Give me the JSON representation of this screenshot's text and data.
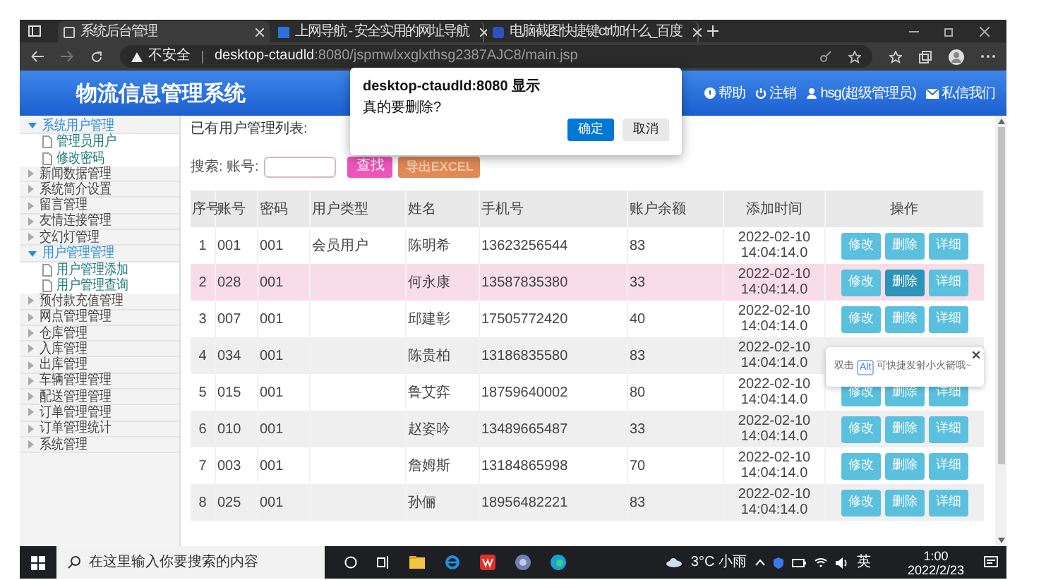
{
  "browser": {
    "tabs": [
      {
        "title": "系统后台管理",
        "selected": true
      },
      {
        "title": "上网导航 - 安全实用的网址导航",
        "selected": false
      },
      {
        "title": "电脑截图快捷键ctrl加什么_百度",
        "selected": false
      }
    ],
    "security": "不安全",
    "url_host": "desktop-ctaudld",
    "url_rest": ":8080/jspmwlxxglxthsg2387AJC8/main.jsp"
  },
  "header": {
    "title": "物流信息管理系统",
    "links": [
      {
        "kind": "help",
        "label": "帮助"
      },
      {
        "kind": "logout",
        "label": "注销"
      },
      {
        "kind": "user",
        "label": "hsg(超级管理员)"
      },
      {
        "kind": "mail",
        "label": "私信我们"
      }
    ]
  },
  "sidebar": {
    "items": [
      {
        "label": "系统用户管理",
        "expanded": true,
        "children": [
          {
            "label": "管理员用户"
          },
          {
            "label": "修改密码"
          }
        ]
      },
      {
        "label": "新闻数据管理",
        "expanded": false
      },
      {
        "label": "系统简介设置",
        "expanded": false
      },
      {
        "label": "留言管理",
        "expanded": false
      },
      {
        "label": "友情连接管理",
        "expanded": false
      },
      {
        "label": "交幻灯管理",
        "expanded": false
      },
      {
        "label": "用户管理管理",
        "expanded": true,
        "children": [
          {
            "label": "用户管理添加"
          },
          {
            "label": "用户管理查询"
          }
        ]
      },
      {
        "label": "预付款充值管理",
        "expanded": false
      },
      {
        "label": "网点管理管理",
        "expanded": false
      },
      {
        "label": "仓库管理",
        "expanded": false
      },
      {
        "label": "入库管理",
        "expanded": false
      },
      {
        "label": "出库管理",
        "expanded": false
      },
      {
        "label": "车辆管理管理",
        "expanded": false
      },
      {
        "label": "配送管理管理",
        "expanded": false
      },
      {
        "label": "订单管理管理",
        "expanded": false
      },
      {
        "label": "订单管理统计",
        "expanded": false
      },
      {
        "label": "系统管理",
        "expanded": false
      }
    ]
  },
  "content": {
    "heading": "已有用户管理列表:",
    "search_label": "搜索: 账号:",
    "search_button": "查找",
    "export_button": "导出EXCEL",
    "table": {
      "columns": [
        "序号",
        "账号",
        "密码",
        "用户类型",
        "姓名",
        "手机号",
        "账户余额",
        "添加时间",
        "操作"
      ],
      "rows": [
        {
          "cells": [
            "1",
            "001",
            "001",
            "会员用户",
            "陈明希",
            "13623256544",
            "83",
            "2022-02-10 14:04:14.0"
          ],
          "highlighted": false,
          "actions": [
            "修改",
            "删除",
            "详细"
          ]
        },
        {
          "cells": [
            "2",
            "028",
            "001",
            "",
            "何永康",
            "13587835380",
            "33",
            "2022-02-10 14:04:14.0"
          ],
          "highlighted": true,
          "actions": [
            "修改",
            "删除",
            "详细"
          ]
        },
        {
          "cells": [
            "3",
            "007",
            "001",
            "",
            "邱建彰",
            "17505772420",
            "40",
            "2022-02-10 14:04:14.0"
          ],
          "highlighted": false,
          "actions": [
            "修改",
            "删除",
            "详细"
          ]
        },
        {
          "cells": [
            "4",
            "034",
            "001",
            "",
            "陈贵柏",
            "13186835580",
            "83",
            "2022-02-10 14:04:14.0"
          ],
          "highlighted": false
        },
        {
          "cells": [
            "5",
            "015",
            "001",
            "",
            "鲁艾弈",
            "18759640002",
            "80",
            "2022-02-10 14:04:14.0"
          ],
          "highlighted": false,
          "actions": [
            "修改",
            "删除",
            "详细"
          ]
        },
        {
          "cells": [
            "6",
            "010",
            "001",
            "",
            "赵姿吟",
            "13489665487",
            "33",
            "2022-02-10 14:04:14.0"
          ],
          "highlighted": false,
          "actions": [
            "修改",
            "删除",
            "详细"
          ]
        },
        {
          "cells": [
            "7",
            "003",
            "001",
            "",
            "詹姆斯",
            "13184865998",
            "70",
            "2022-02-10 14:04:14.0"
          ],
          "highlighted": false,
          "actions": [
            "修改",
            "删除",
            "详细"
          ]
        },
        {
          "cells": [
            "8",
            "025",
            "001",
            "",
            "孙俪",
            "18956482221",
            "83",
            "2022-02-10 14:04:14.0"
          ],
          "highlighted": false,
          "actions": [
            "修改",
            "删除",
            "详细"
          ]
        }
      ]
    }
  },
  "dialog": {
    "title": "desktop-ctaudld:8080 显示",
    "message": "真的要删除?",
    "ok": "确定",
    "cancel": "取消"
  },
  "tooltip": {
    "before": "双击",
    "key": "Alt",
    "after": "可快捷发射小火箭哦~"
  },
  "taskbar": {
    "search_placeholder": "在这里输入你要搜索的内容",
    "weather": "3°C 小雨",
    "ime": "英",
    "time": "1:00",
    "date": "2022/2/23"
  }
}
